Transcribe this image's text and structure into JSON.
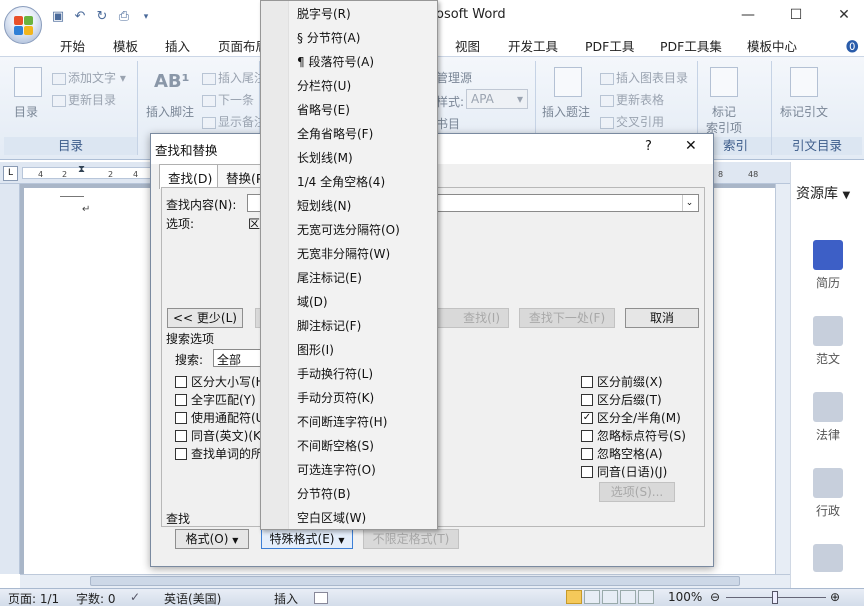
{
  "window": {
    "title": "osoft Word",
    "minimize": "—",
    "maximize": "☐",
    "close": "✕"
  },
  "ribbon_tabs": [
    "开始",
    "模板",
    "插入",
    "页面布局",
    "视图",
    "开发工具",
    "PDF工具",
    "PDF工具集",
    "模板中心"
  ],
  "ribbon": {
    "toc_group": {
      "label": "目录",
      "toc_button": "目录",
      "add_text": "添加文字",
      "update_toc": "更新目录"
    },
    "footnote_group": {
      "insert_footnote": "插入脚注",
      "insert_endnote": "插入尾注",
      "next": "下一条",
      "show_notes": "显示备注"
    },
    "citation_group": {
      "manage_sources": "管理源",
      "style_label": "样式:",
      "style_value": "APA",
      "bibliography": "书目"
    },
    "caption_group": {
      "insert_caption": "插入题注",
      "insert_table_of_figures": "插入图表目录",
      "update_table": "更新表格",
      "cross_reference": "交叉引用"
    },
    "index_group": {
      "label": "索引",
      "mark_entry": "标记",
      "mark_entry2": "索引项"
    },
    "toa_group": {
      "label": "引文目录",
      "mark_citation": "标记引文"
    }
  },
  "ruler_numbers": [
    "4",
    "2",
    "",
    "2",
    "4",
    "6",
    "8",
    "48"
  ],
  "side_panel": {
    "title": "资源库",
    "items": [
      "简历",
      "范文",
      "法律",
      "行政"
    ]
  },
  "status_bar": {
    "page": "页面: 1/1",
    "words": "字数: 0",
    "language": "英语(美国)",
    "mode": "插入",
    "zoom": "100%"
  },
  "dialog": {
    "title": "查找和替换",
    "help": "?",
    "close": "✕",
    "tabs": [
      "查找(D)",
      "替换(P)"
    ],
    "find_label": "查找内容(N):",
    "options_label": "选项:",
    "options_value": "区",
    "less_button": "<< 更少(L)",
    "find_in_button": "在以下项中查找(I)",
    "find_in_visible": "查找(I)",
    "find_next_button": "查找下一处(F)",
    "cancel_button": "取消",
    "search_options_label": "搜索选项",
    "search_label": "搜索:",
    "search_value": "全部",
    "left_checks": [
      {
        "label": "区分大小写(H)",
        "checked": false
      },
      {
        "label": "全字匹配(Y)",
        "checked": false
      },
      {
        "label": "使用通配符(U)",
        "checked": false
      },
      {
        "label": "同音(英文)(K)",
        "checked": false
      },
      {
        "label": "查找单词的所有形式(英文)(W)",
        "checked": false
      }
    ],
    "right_checks": [
      {
        "label": "区分前缀(X)",
        "checked": false
      },
      {
        "label": "区分后缀(T)",
        "checked": false
      },
      {
        "label": "区分全/半角(M)",
        "checked": true
      },
      {
        "label": "忽略标点符号(S)",
        "checked": false
      },
      {
        "label": "忽略空格(A)",
        "checked": false
      },
      {
        "label": "同音(日语)(J)",
        "checked": false
      }
    ],
    "options_button": "选项(S)...",
    "find_section_label": "查找",
    "format_button": "格式(O)",
    "special_button": "特殊格式(E)",
    "no_format_button": "不限定格式(T)"
  },
  "special_menu": [
    "脱字号(R)",
    "§ 分节符(A)",
    "¶ 段落符号(A)",
    "分栏符(U)",
    "省略号(E)",
    "全角省略号(F)",
    "长划线(M)",
    "1/4 全角空格(4)",
    "短划线(N)",
    "无宽可选分隔符(O)",
    "无宽非分隔符(W)",
    "尾注标记(E)",
    "域(D)",
    "脚注标记(F)",
    "图形(I)",
    "手动换行符(L)",
    "手动分页符(K)",
    "不间断连字符(H)",
    "不间断空格(S)",
    "可选连字符(O)",
    "分节符(B)",
    "空白区域(W)"
  ]
}
